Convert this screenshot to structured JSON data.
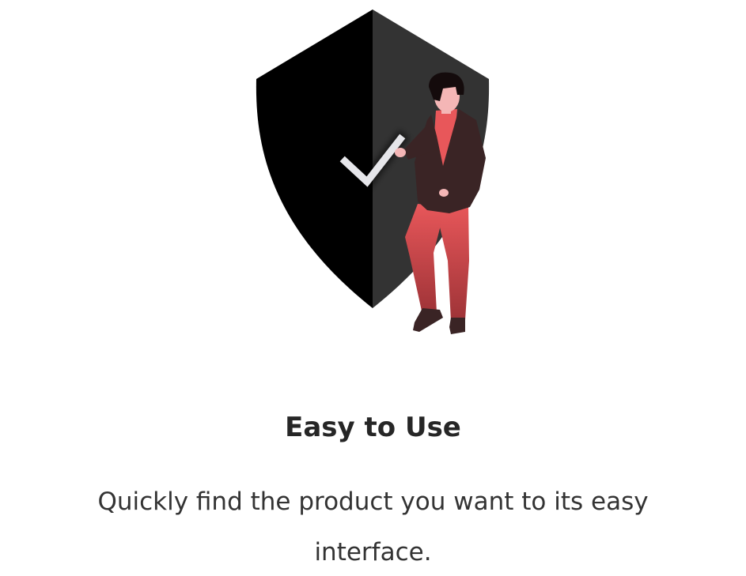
{
  "feature": {
    "illustration_icon": "shield-check-person-illustration",
    "title": "Easy to Use",
    "description": "Quickly find the product you want to its easy interface."
  },
  "colors": {
    "background": "#ffffff",
    "shield_left": "#000000",
    "shield_right": "#333333",
    "accent": "#e8575a",
    "jacket": "#3a2425",
    "title_text": "#262626",
    "body_text": "#333333"
  }
}
